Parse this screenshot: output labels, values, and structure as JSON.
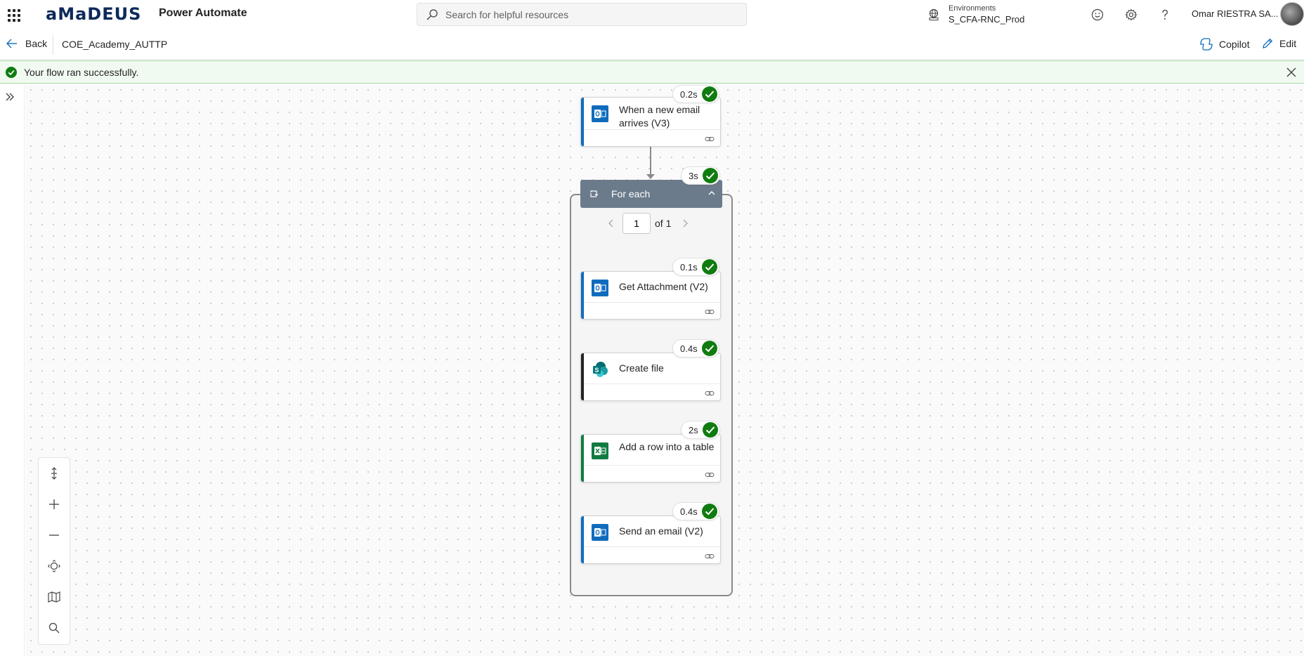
{
  "header": {
    "brand": "aMaDEUS",
    "app_name": "Power Automate",
    "search_placeholder": "Search for helpful resources",
    "environment_label": "Environments",
    "environment_value": "S_CFA-RNC_Prod",
    "user_name": "Omar RIESTRA SA..."
  },
  "toolbar": {
    "back_label": "Back",
    "flow_name": "COE_Academy_AUTTP",
    "copilot_label": "Copilot",
    "edit_label": "Edit"
  },
  "banner": {
    "message": "Your flow ran successfully."
  },
  "flow": {
    "trigger": {
      "title": "When a new email arrives (V3)",
      "duration": "0.2s"
    },
    "foreach": {
      "title": "For each",
      "duration": "3s",
      "page_current": "1",
      "page_total_label": "of 1"
    },
    "actions": [
      {
        "title": "Get Attachment (V2)",
        "duration": "0.1s"
      },
      {
        "title": "Create file",
        "duration": "0.4s"
      },
      {
        "title": "Add a row into a table",
        "duration": "2s"
      },
      {
        "title": "Send an email (V2)",
        "duration": "0.4s"
      }
    ]
  },
  "colors": {
    "success": "#107c10",
    "outlook_blue": "#0f6cbd",
    "excel_green": "#107c41",
    "sharepoint_teal": "#03787c",
    "foreach_header": "#6b7b8c",
    "banner_bg": "#f1faf1"
  },
  "icons": {
    "zoom_panel": [
      "fit-height-icon",
      "zoom-in-icon",
      "zoom-out-icon",
      "center-icon",
      "minimap-icon",
      "search-icon"
    ]
  }
}
